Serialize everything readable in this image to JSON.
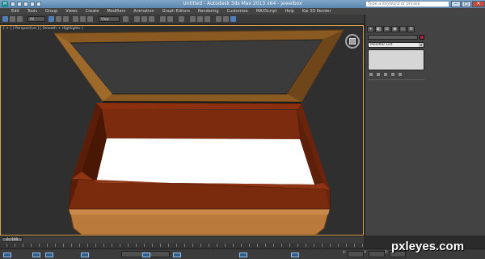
{
  "window": {
    "title": "Untitled - Autodesk 3ds Max 2013 x64 - jewelbox",
    "search_placeholder": "Type a keyword or phrase",
    "app_icon_label": "M",
    "controls": [
      "–",
      "□",
      "✕"
    ]
  },
  "menu": {
    "items": [
      "Edit",
      "Tools",
      "Group",
      "Views",
      "Create",
      "Modifiers",
      "Animation",
      "Graph Editors",
      "Rendering",
      "Customize",
      "MAXScript",
      "Help",
      "Kai 3D Render"
    ]
  },
  "toolbar": {
    "selection_filter": "All",
    "reference_coord": "View"
  },
  "viewport": {
    "label": "[ + ] [ Perspective ] [ Smooth + Highlights ]",
    "accent_border": "#d8a04a"
  },
  "command_panel": {
    "tabs": [
      "+",
      "◐",
      "⊟",
      "◉",
      "▭",
      "⚒"
    ],
    "modifier_list": "Modifier List",
    "modifier_list_arrow": "▾",
    "swatch_color": "#b0213c"
  },
  "timeline": {
    "slider_label": "0 / 100"
  },
  "status": {
    "coord_x": "X:",
    "coord_y": "Y:",
    "coord_z": "Z:"
  },
  "watermark": {
    "text": "pxleyes.com"
  },
  "scene": {
    "box_outer_color": "#7a2a0d",
    "box_inner_color": "#ffffff",
    "lid_wood_color": "#8a5a22",
    "lid_glass_color": "#3a3a3a",
    "base_color": "#b97a3c"
  }
}
